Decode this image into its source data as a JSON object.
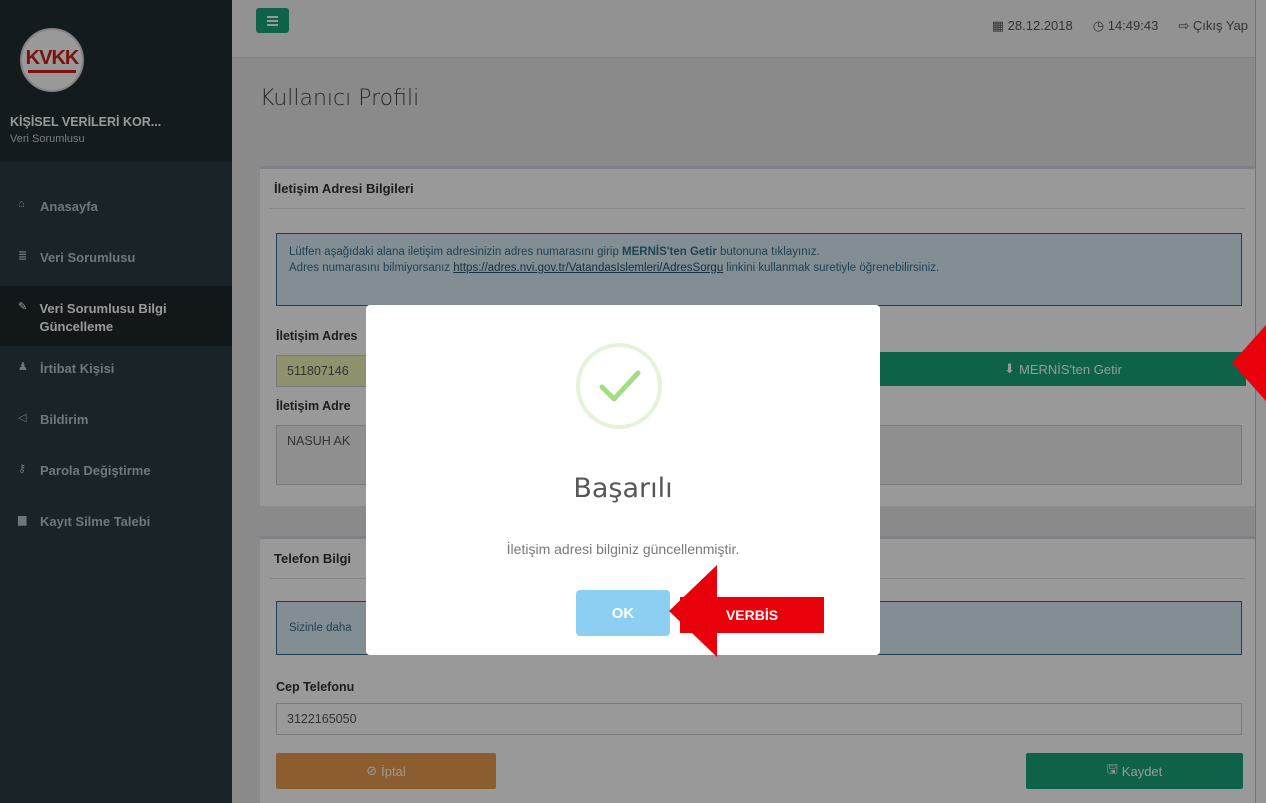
{
  "sidebar": {
    "logo_text": "KVKK",
    "org_title": "KİŞİSEL VERİLERİ KOR...",
    "org_subtitle": "Veri Sorumlusu",
    "items": [
      {
        "label": "Anasayfa",
        "icon": "home-icon",
        "glyph": "🏠"
      },
      {
        "label": "Veri Sorumlusu",
        "icon": "database-icon",
        "glyph": "≣"
      },
      {
        "label": "Veri Sorumlusu Bilgi Güncelleme",
        "icon": "edit-icon",
        "glyph": "✎"
      },
      {
        "label": "İrtibat Kişisi",
        "icon": "user-icon",
        "glyph": "👤"
      },
      {
        "label": "Bildirim",
        "icon": "bullhorn-icon",
        "glyph": "📢"
      },
      {
        "label": "Parola Değiştirme",
        "icon": "key-icon",
        "glyph": "🔑"
      },
      {
        "label": "Kayıt Silme Talebi",
        "icon": "trash-icon",
        "glyph": "🗑"
      }
    ]
  },
  "topbar": {
    "date": "28.12.2018",
    "time": "14:49:43",
    "logout": "Çıkış Yap"
  },
  "page": {
    "title": "Kullanıcı Profili"
  },
  "address_box": {
    "header": "İletişim Adresi Bilgileri",
    "info_line1_pre": "Lütfen aşağıdaki alana iletişim adresinizin adres numarasını girip ",
    "info_line1_bold": "MERNİS'ten Getir",
    "info_line1_post": " butonuna tıklayınız.",
    "info_line2_pre": "Adres numarasını bilmiyorsanız ",
    "info_line2_link": "https://adres.nvi.gov.tr/VatandasIslemleri/AdresSorgu",
    "info_line2_post": " linkini kullanmak suretiyle öğrenebilirsiniz.",
    "address_no_label": "İletişim Adres",
    "address_no_value": "511807146",
    "mernis_button": "MERNİS'ten Getir",
    "address_label": "İletişim Adre",
    "address_value": "NASUH AK"
  },
  "phone_box": {
    "header": "Telefon Bilgi",
    "info_text": "Sizinle daha",
    "mobile_label": "Cep Telefonu",
    "mobile_value": "3122165050",
    "cancel_button": "İptal",
    "save_button": "Kaydet"
  },
  "modal": {
    "title": "Başarılı",
    "message": "İletişim adresi bilginiz güncellenmiştir.",
    "ok_button": "OK"
  },
  "annotation": {
    "label": "VERBİS",
    "color": "#e8000a"
  }
}
